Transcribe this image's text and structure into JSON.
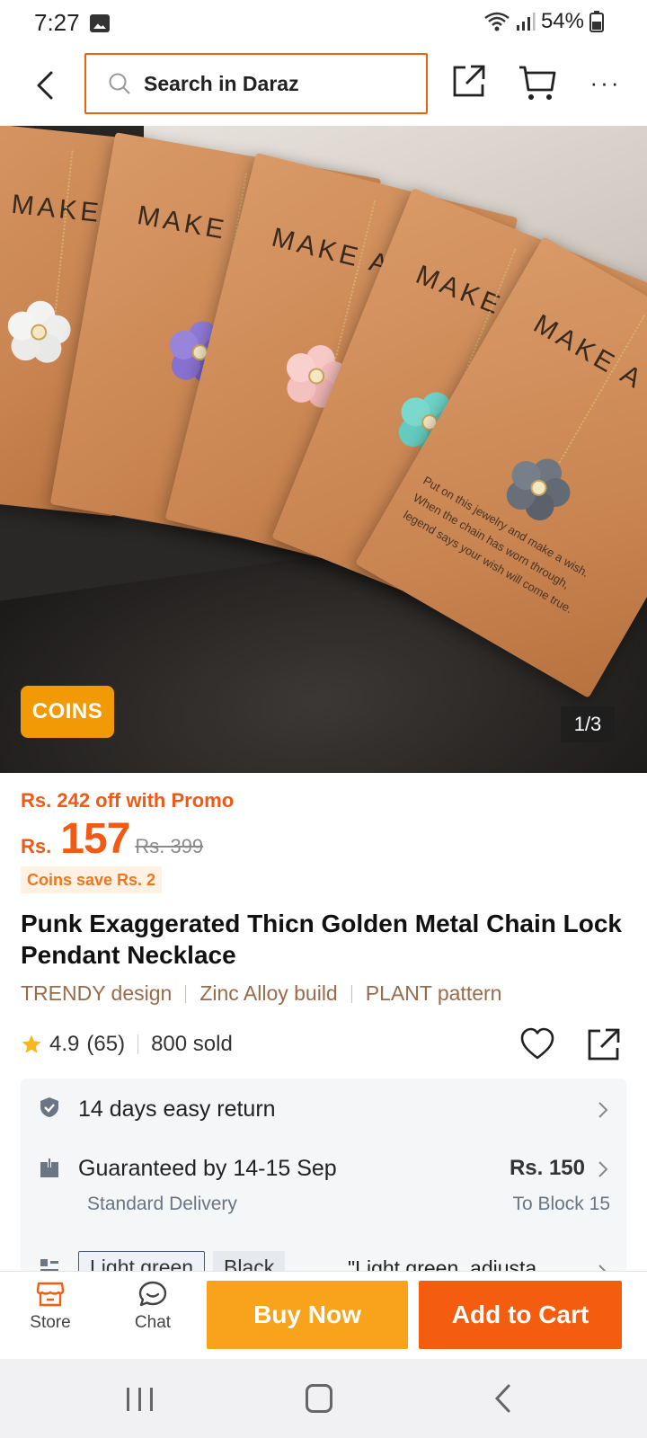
{
  "status_bar": {
    "time": "7:27",
    "battery": "54%"
  },
  "top_nav": {
    "search_placeholder": "Search in Daraz",
    "more_label": "···"
  },
  "hero": {
    "coins_badge": "COINS",
    "page_indicator": "1/3",
    "card_heading": "MAKE A",
    "card_text": "Put on this jewelry and make a wish. When the chain has worn through, legend says your wish will come true."
  },
  "price": {
    "promo": "Rs. 242 off with Promo",
    "currency": "Rs.",
    "current": "157",
    "original": "Rs. 399",
    "coins_save": "Coins save Rs. 2"
  },
  "product": {
    "title": "Punk Exaggerated Thicn Golden Metal Chain Lock Pendant Necklace",
    "attributes": [
      "TRENDY design",
      "Zinc Alloy build",
      "PLANT pattern"
    ],
    "rating": "4.9",
    "rating_count": "(65)",
    "sold": "800 sold"
  },
  "info": {
    "return": "14 days easy return",
    "delivery_title": "Guaranteed by 14-15 Sep",
    "delivery_type": "Standard Delivery",
    "delivery_price": "Rs. 150",
    "delivery_location": "To Block 15",
    "variants": [
      "Light green",
      "Black"
    ],
    "variant_desc": "\"Light green, adjusta"
  },
  "action_bar": {
    "store_label": "Store",
    "chat_label": "Chat",
    "buy_now": "Buy Now",
    "add_to_cart": "Add to Cart"
  },
  "colors": {
    "accent": "#f45d0f",
    "buy_now": "#f9a21b",
    "search_border": "#e8630a",
    "coins": "#f29a05"
  }
}
